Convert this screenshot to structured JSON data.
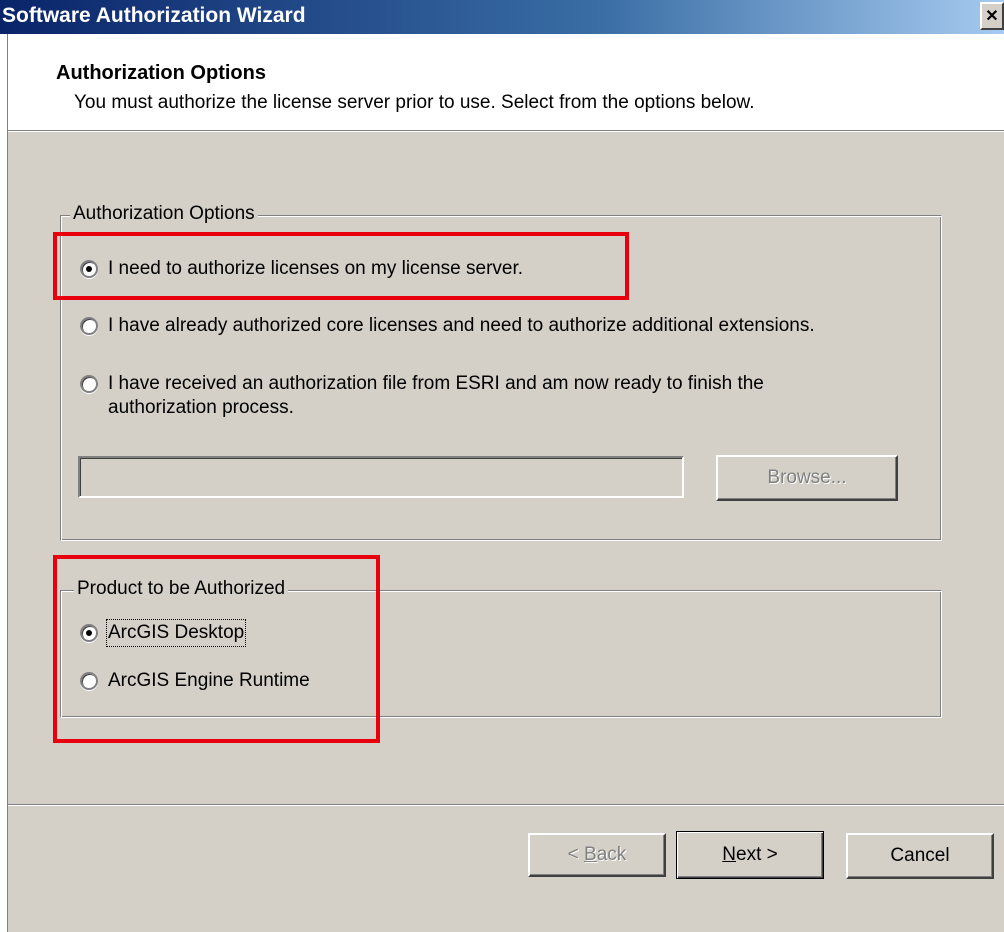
{
  "window": {
    "title": "Software Authorization Wizard",
    "close_glyph": "✕"
  },
  "header": {
    "title": "Authorization Options",
    "subtitle": "You must authorize the license server prior to use. Select from the options below."
  },
  "authorization_options": {
    "legend": "Authorization Options",
    "options": [
      {
        "label": "I need to authorize licenses on my license server.",
        "checked": true
      },
      {
        "label": "I have already authorized core licenses and need to authorize additional extensions.",
        "checked": false
      },
      {
        "label_line1": "I have received an authorization file from ESRI and am now ready to finish the",
        "label_line2": "authorization process.",
        "checked": false
      }
    ],
    "file_path_value": "",
    "browse_label": "Browse..."
  },
  "product": {
    "legend": "Product to be Authorized",
    "options": [
      {
        "label": "ArcGIS Desktop",
        "checked": true
      },
      {
        "label": "ArcGIS Engine Runtime",
        "checked": false
      }
    ]
  },
  "footer": {
    "back_label_prefix": "< ",
    "back_label_mnemonic": "B",
    "back_label_rest": "ack",
    "next_label_mnemonic": "N",
    "next_label_rest": "ext >",
    "cancel_label": "Cancel"
  },
  "colors": {
    "titlebar_start": "#0a246a",
    "dialog_face": "#d4d0c8",
    "highlight": "#e8000c"
  }
}
